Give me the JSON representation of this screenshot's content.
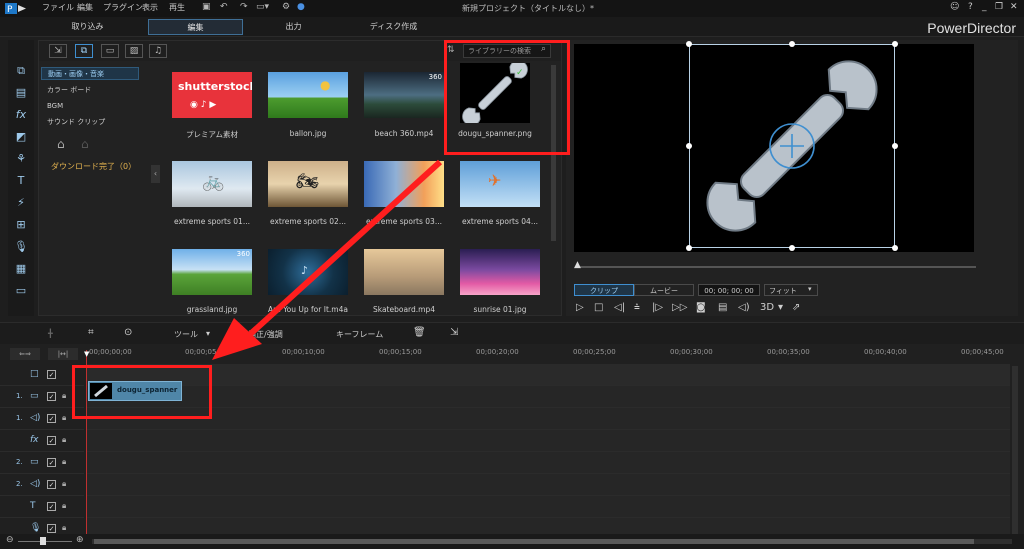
{
  "menu": {
    "items": [
      "ファイル",
      "編集",
      "プラグイン",
      "表示",
      "再生"
    ],
    "title": "新規プロジェクト（タイトルなし）*"
  },
  "modes": {
    "tabs": [
      "取り込み",
      "編集",
      "出力",
      "ディスク作成"
    ],
    "active": "編集",
    "brand": "PowerDirector"
  },
  "library": {
    "search_placeholder": "ライブラリーの検索",
    "categories": [
      "動画・画像・音楽",
      "カラー ボード",
      "BGM",
      "サウンド クリップ"
    ],
    "download_status": "ダウンロード完了（0）",
    "items": [
      {
        "label": "プレミアム素材",
        "thumb": "shutterstock"
      },
      {
        "label": "ballon.jpg",
        "thumb": "balloons"
      },
      {
        "label": "beach 360.mp4",
        "thumb": "beach",
        "badge": "360"
      },
      {
        "label": "dougu_spanner.png",
        "thumb": "spanner"
      },
      {
        "label": "extreme sports 01...",
        "thumb": "bmx"
      },
      {
        "label": "extreme sports 02...",
        "thumb": "moto"
      },
      {
        "label": "extreme sports 03...",
        "thumb": "sunset"
      },
      {
        "label": "extreme sports 04...",
        "thumb": "skydive"
      },
      {
        "label": "grassland.jpg",
        "thumb": "grass",
        "badge": "360"
      },
      {
        "label": "Are You Up for It.m4a",
        "thumb": "audio"
      },
      {
        "label": "Skateboard.mp4",
        "thumb": "skate"
      },
      {
        "label": "sunrise 01.jpg",
        "thumb": "flowers"
      }
    ],
    "shutterstock_text": "shutterstock"
  },
  "preview": {
    "clip_tab": "クリップ",
    "movie_tab": "ムービー",
    "timecode": "00; 00; 00; 00",
    "fit": "フィット",
    "mode3d": "3D"
  },
  "timeline_toolbar": {
    "tools": "ツール",
    "fix": "補正/強調",
    "keyframe": "キーフレーム"
  },
  "timeline": {
    "ticks": [
      "00;00;00;00",
      "00;00;05;00",
      "00;00;10;00",
      "00;00;15;00",
      "00;00;20;00",
      "00;00;25;00",
      "00;00;30;00",
      "00;00;35;00",
      "00;00;40;00",
      "00;00;45;00"
    ],
    "tracks": [
      {
        "num": "",
        "icon": "□"
      },
      {
        "num": "1.",
        "icon": "▭"
      },
      {
        "num": "1.",
        "icon": "◁)"
      },
      {
        "num": "",
        "icon": "fx"
      },
      {
        "num": "2.",
        "icon": "▭"
      },
      {
        "num": "2.",
        "icon": "◁)"
      },
      {
        "num": "",
        "icon": "T"
      },
      {
        "num": "",
        "icon": "🎙"
      }
    ],
    "clip_label": "dougu_spanner"
  },
  "colors": {
    "accent": "#3f8fd0",
    "highlight": "#ff1e1e",
    "clip": "#4f86a8"
  }
}
